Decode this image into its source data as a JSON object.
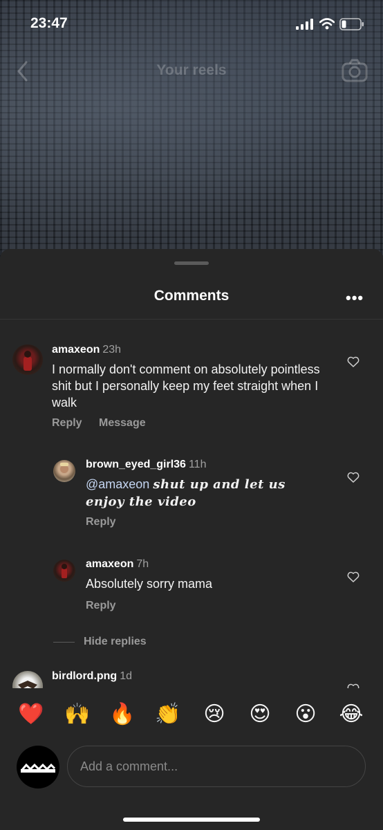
{
  "status": {
    "time": "23:47"
  },
  "nav": {
    "title": "Your reels"
  },
  "sheet": {
    "title": "Comments",
    "more_label": "•••"
  },
  "comments": [
    {
      "username": "amaxeon",
      "time": "23h",
      "text": "I normally don't comment on absolutely pointless shit but I personally keep my feet straight when I walk",
      "reply_label": "Reply",
      "message_label": "Message"
    }
  ],
  "replies": [
    {
      "username": "brown_eyed_girl36",
      "time": "11h",
      "mention": "@amaxeon",
      "text": "shut up and let us enjoy the video",
      "reply_label": "Reply"
    },
    {
      "username": "amaxeon",
      "time": "7h",
      "text": "Absolutely sorry mama",
      "reply_label": "Reply"
    }
  ],
  "hide_replies_label": "Hide replies",
  "partial_comment": {
    "username": "birdlord.png",
    "time": "1d"
  },
  "emojis": [
    "❤️",
    "🙌",
    "🔥",
    "👏",
    "😢",
    "😍",
    "😮",
    "😂"
  ],
  "composer": {
    "placeholder": "Add a comment..."
  },
  "colors": {
    "sheet_bg": "#262626",
    "mention": "#c5d6f2",
    "secondary_text": "#9a9a9a"
  }
}
